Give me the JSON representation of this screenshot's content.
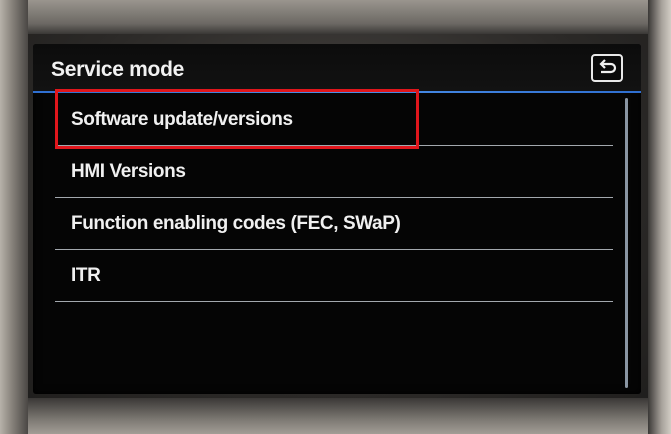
{
  "header": {
    "title": "Service mode"
  },
  "menu": {
    "items": [
      {
        "label": "Software update/versions",
        "selected": true
      },
      {
        "label": "HMI Versions",
        "selected": false
      },
      {
        "label": "Function enabling codes (FEC, SWaP)",
        "selected": false
      },
      {
        "label": "ITR",
        "selected": false
      }
    ]
  },
  "colors": {
    "accent_line": "#3a7fe0",
    "highlight_box": "#e0161c",
    "text": "#f0f0f0",
    "background": "#050505"
  },
  "icons": {
    "back": "back-arrow-icon"
  }
}
